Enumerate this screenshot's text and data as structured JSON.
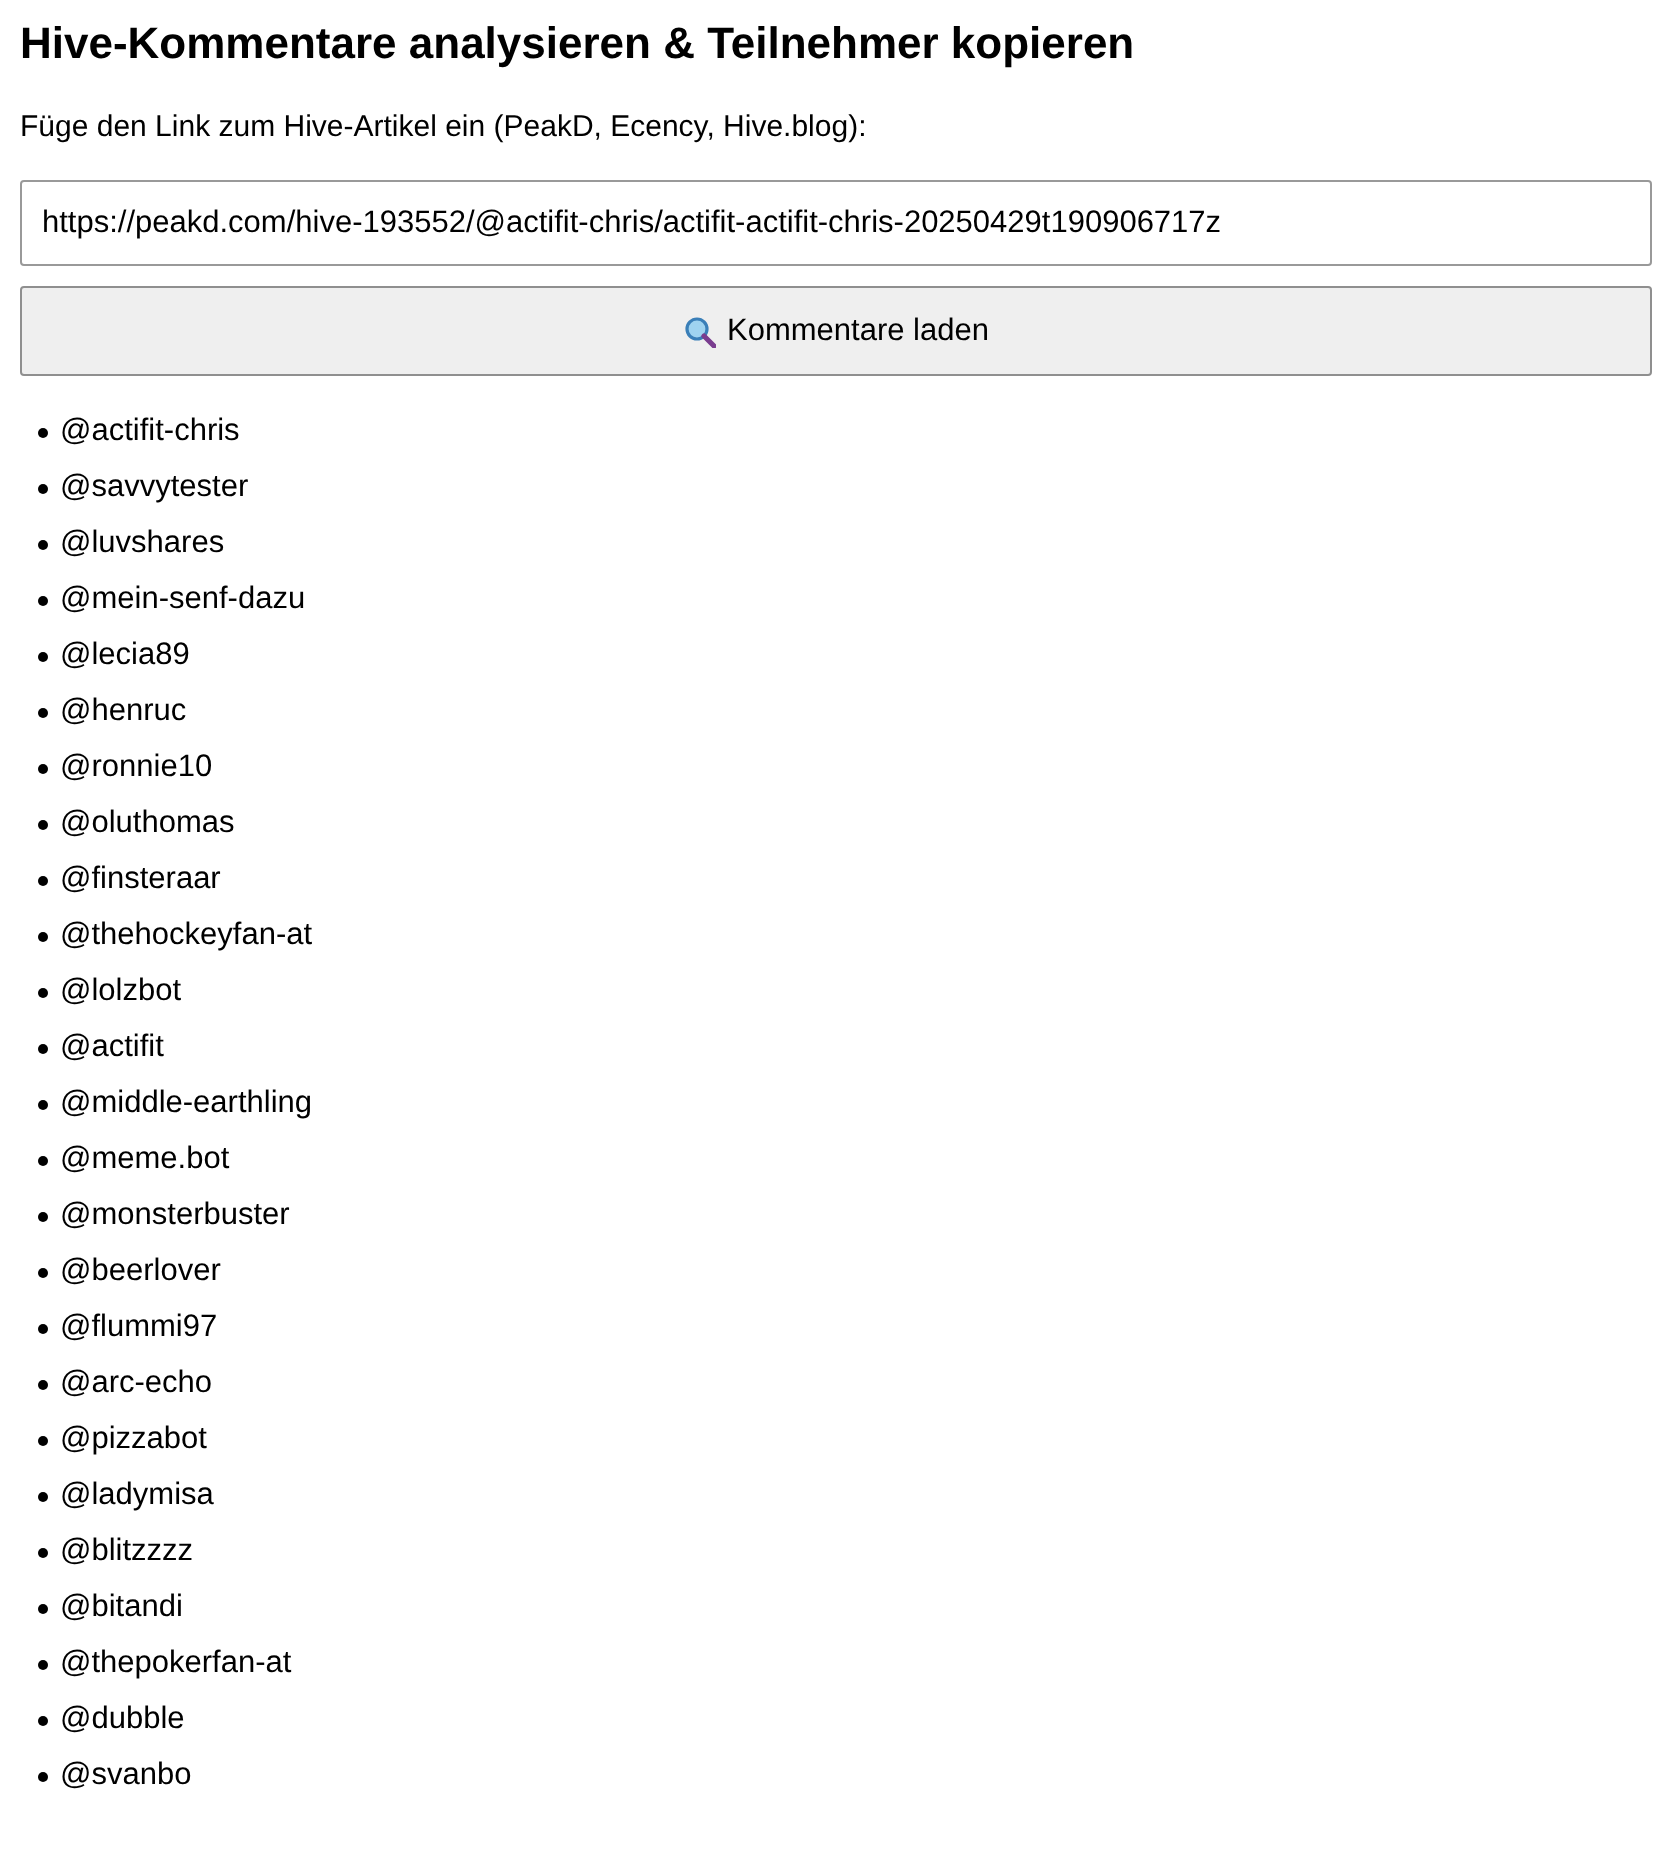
{
  "title": "Hive-Kommentare analysieren & Teilnehmer kopieren",
  "instruction": "Füge den Link zum Hive-Artikel ein (PeakD, Ecency, Hive.blog):",
  "url_field": {
    "value": "https://peakd.com/hive-193552/@actifit-chris/actifit-actifit-chris-20250429t190906717z"
  },
  "load_button": {
    "label": "Kommentare laden"
  },
  "participants": [
    "@actifit-chris",
    "@savvytester",
    "@luvshares",
    "@mein-senf-dazu",
    "@lecia89",
    "@henruc",
    "@ronnie10",
    "@oluthomas",
    "@finsteraar",
    "@thehockeyfan-at",
    "@lolzbot",
    "@actifit",
    "@middle-earthling",
    "@meme.bot",
    "@monsterbuster",
    "@beerlover",
    "@flummi97",
    "@arc-echo",
    "@pizzabot",
    "@ladymisa",
    "@blitzzzz",
    "@bitandi",
    "@thepokerfan-at",
    "@dubble",
    "@svanbo"
  ]
}
